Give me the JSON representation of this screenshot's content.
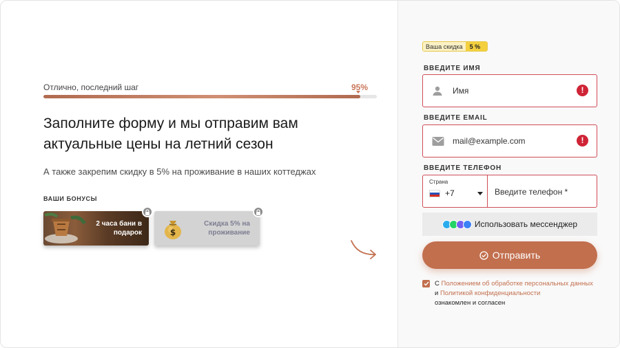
{
  "progress": {
    "label": "Отлично, последний шаг",
    "percent_label": "95%",
    "value": 95
  },
  "headline": "Заполните форму и мы отправим вам актуальные цены на летний сезон",
  "subtitle": "А также закрепим скидку в 5% на проживание в наших коттеджах",
  "bonuses": {
    "heading": "ВАШИ БОНУСЫ",
    "items": [
      {
        "line1": "2 часа бани в",
        "line2": "подарок"
      },
      {
        "line1": "Скидка 5% на",
        "line2": "проживание"
      }
    ]
  },
  "discount_badge": {
    "label": "Ваша скидка",
    "value": "5 %"
  },
  "form": {
    "name": {
      "label": "ВВЕДИТЕ ИМЯ",
      "placeholder": "Имя",
      "error_icon": "!"
    },
    "email": {
      "label": "ВВЕДИТЕ EMAIL",
      "placeholder": "mail@example.com",
      "error_icon": "!"
    },
    "phone": {
      "label": "ВВЕДИТЕ ТЕЛЕФОН",
      "country_label": "Страна",
      "code": "+7",
      "placeholder": "Введите телефон *"
    },
    "messenger_button": "Использовать мессенджер",
    "submit_button": "Отправить",
    "consent": {
      "prefix": "С ",
      "link1": "Положением об обработке персональных данных",
      "middle": " и ",
      "link2": "Политикой конфиденциальности",
      "suffix": " ознакомлен и согласен"
    }
  },
  "colors": {
    "accent": "#c26f4e",
    "error": "#cf4b57",
    "badge": "#f4d03f"
  }
}
